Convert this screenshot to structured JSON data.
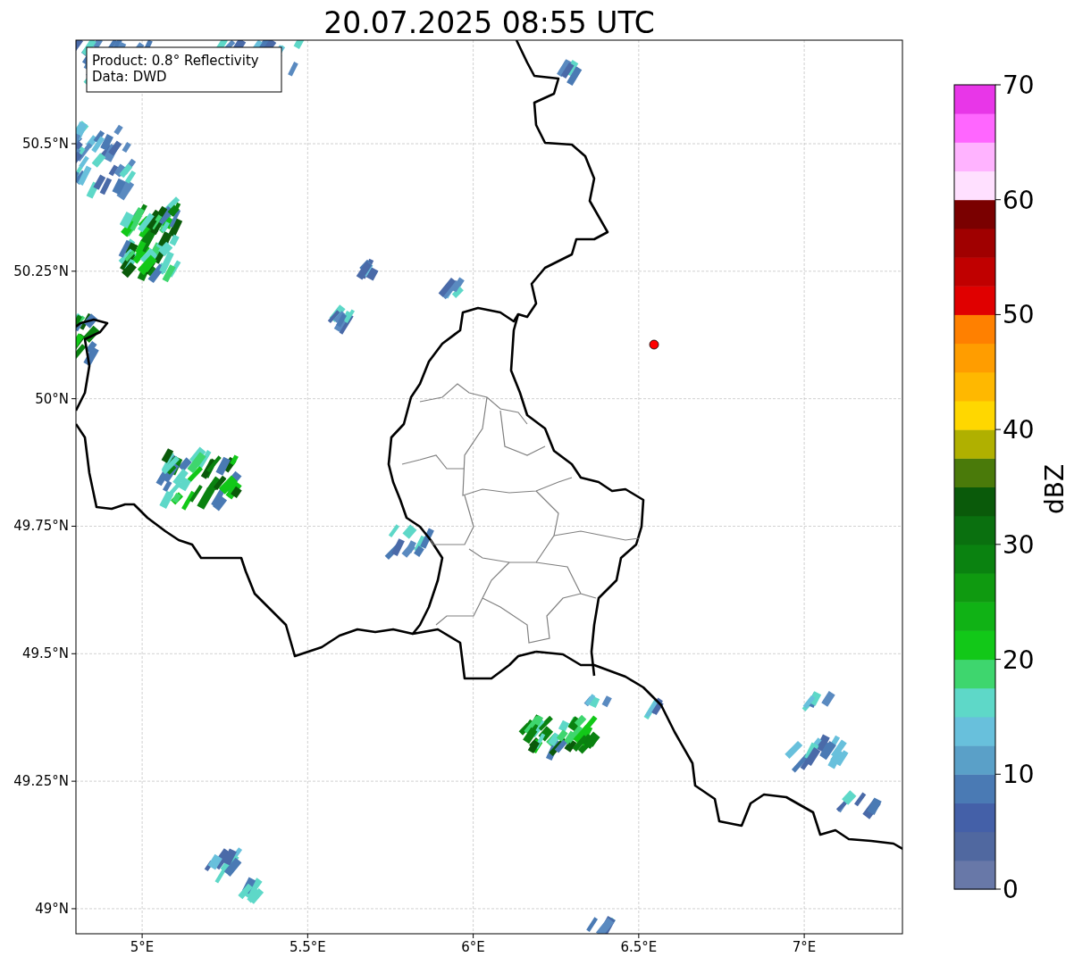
{
  "title": "20.07.2025 08:55 UTC",
  "info_box": {
    "lines": [
      "Product: 0.8° Reflectivity",
      "Data: DWD"
    ]
  },
  "map": {
    "x_ticks": [
      "5°E",
      "5.5°E",
      "6°E",
      "6.5°E",
      "7°E"
    ],
    "y_ticks": [
      "50.5°N",
      "50.25°N",
      "50°N",
      "49.75°N",
      "49.5°N",
      "49.25°N",
      "49°N"
    ]
  },
  "colorbar": {
    "label": "dBZ",
    "ticks": [
      "70",
      "60",
      "50",
      "40",
      "30",
      "20",
      "10",
      "0"
    ],
    "bins": [
      {
        "color": "#6878a8"
      },
      {
        "color": "#5068a0"
      },
      {
        "color": "#4460a8"
      },
      {
        "color": "#4a7ab4"
      },
      {
        "color": "#5aa0c8"
      },
      {
        "color": "#68c0dc"
      },
      {
        "color": "#5ed8c8"
      },
      {
        "color": "#3ed66e"
      },
      {
        "color": "#12c818"
      },
      {
        "color": "#10b215"
      },
      {
        "color": "#0f9a10"
      },
      {
        "color": "#0a8210"
      },
      {
        "color": "#0a700f"
      },
      {
        "color": "#0a5a0a"
      },
      {
        "color": "#4a7a0a"
      },
      {
        "color": "#b0b000"
      },
      {
        "color": "#ffd700"
      },
      {
        "color": "#ffb800"
      },
      {
        "color": "#ff9d00"
      },
      {
        "color": "#ff8000"
      },
      {
        "color": "#e00000"
      },
      {
        "color": "#c00000"
      },
      {
        "color": "#a00000"
      },
      {
        "color": "#7a0000"
      },
      {
        "color": "#ffe0ff"
      },
      {
        "color": "#ffb3ff"
      },
      {
        "color": "#ff66ff"
      },
      {
        "color": "#e836e8"
      }
    ]
  }
}
